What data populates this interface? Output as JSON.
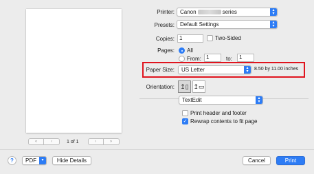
{
  "printer": {
    "label": "Printer:",
    "value_prefix": "Canon",
    "value_suffix": "series"
  },
  "presets": {
    "label": "Presets:",
    "value": "Default Settings"
  },
  "copies": {
    "label": "Copies:",
    "value": "1",
    "two_sided_label": "Two-Sided"
  },
  "pages": {
    "label": "Pages:",
    "all_label": "All",
    "from_label": "From:",
    "from_value": "1",
    "to_label": "to:",
    "to_value": "1"
  },
  "paper_size": {
    "label": "Paper Size:",
    "value": "US Letter",
    "dimensions": "8.50 by 11.00 inches"
  },
  "orientation": {
    "label": "Orientation:"
  },
  "app_section": {
    "value": "TextEdit"
  },
  "options": {
    "print_header_footer": "Print header and footer",
    "rewrap": "Rewrap contents to fit page"
  },
  "preview": {
    "page_indicator": "1 of 1"
  },
  "footer": {
    "help": "?",
    "pdf_label": "PDF",
    "hide_details_label": "Hide Details",
    "cancel_label": "Cancel",
    "print_label": "Print"
  },
  "colors": {
    "accent": "#2d7cf5",
    "highlight_box": "#e0141e"
  }
}
